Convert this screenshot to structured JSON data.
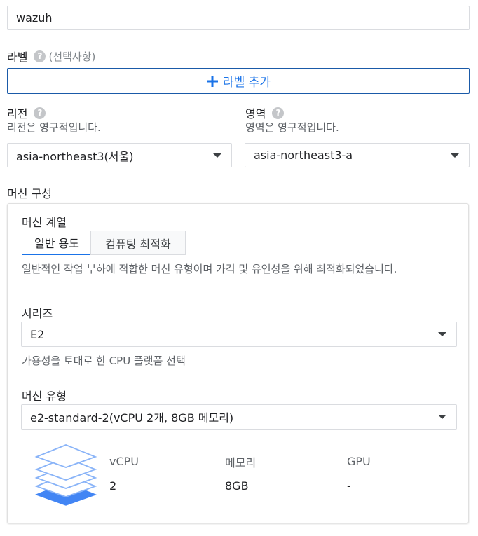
{
  "name_field": {
    "value": "wazuh"
  },
  "labels": {
    "title": "라벨",
    "optional": "(선택사항)",
    "help_icon": "help-icon",
    "add_button": "라벨 추가",
    "add_icon": "plus-icon"
  },
  "region": {
    "title": "리전",
    "note": "리전은 영구적입니다.",
    "value": "asia-northeast3(서울)"
  },
  "zone": {
    "title": "영역",
    "note": "영역은 영구적입니다.",
    "value": "asia-northeast3-a"
  },
  "machine_config": {
    "title": "머신 구성",
    "family_title": "머신 계열",
    "tabs": [
      {
        "label": "일반 용도",
        "active": true
      },
      {
        "label": "컴퓨팅 최적화",
        "active": false
      }
    ],
    "family_description": "일반적인 작업 부하에 적합한 머신 유형이며 가격 및 유연성을 위해 최적화되었습니다.",
    "series_title": "시리즈",
    "series_value": "E2",
    "series_note": "가용성을 토대로 한 CPU 플랫폼 선택",
    "type_title": "머신 유형",
    "type_value": "e2-standard-2(vCPU 2개, 8GB 메모리)",
    "stack_icon": "stacked-layers-icon",
    "specs": {
      "vcpu_label": "vCPU",
      "vcpu_value": "2",
      "memory_label": "메모리",
      "memory_value": "8GB",
      "gpu_label": "GPU",
      "gpu_value": "-"
    }
  },
  "colors": {
    "accent": "#1a73e8",
    "button_border": "#1a5aa8",
    "active_tab_underline": "#1a73e8",
    "layer_light": "#8ab4f8",
    "layer_dark": "#4285f4"
  }
}
